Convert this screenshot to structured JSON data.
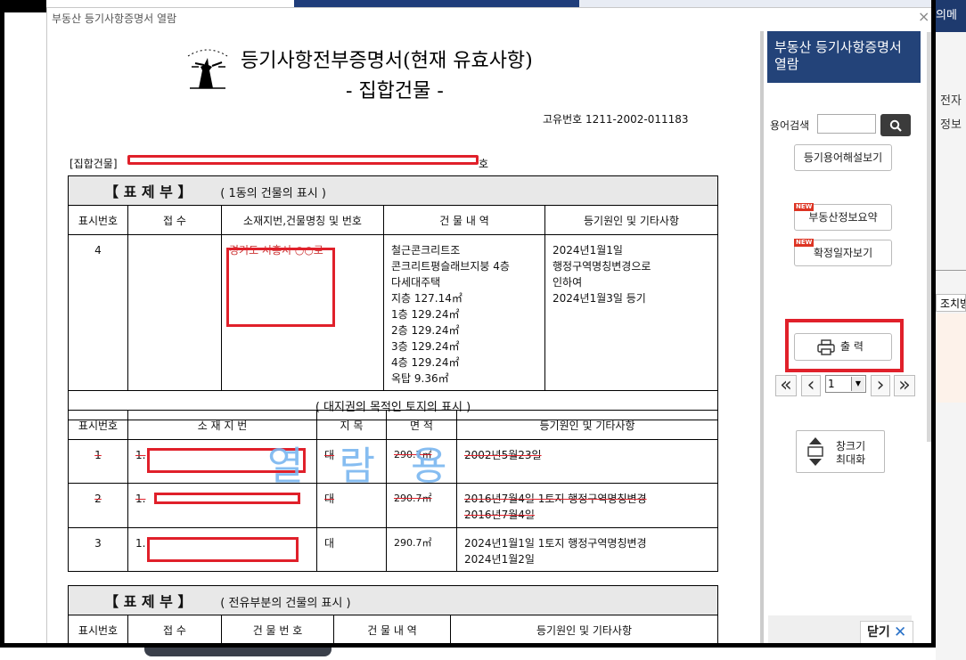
{
  "modal": {
    "title": "부동산 등기사항증명서 열람",
    "close_glyph": "×"
  },
  "background": {
    "right_header": "의메",
    "right_text1": "전자",
    "right_text2": "정보",
    "right_button": "조치방"
  },
  "document": {
    "title": "등기사항전부증명서(현재 유효사항)",
    "subtitle": "- 집합건물 -",
    "unique_number": "고유번호 1211-2002-011183",
    "building_label": "[집합건물]",
    "building_suffix": "호",
    "watermark": "열람용",
    "section1": {
      "bracket": "【 표 제 부 】",
      "desc": "( 1동의 건물의 표시 )",
      "headers": [
        "표시번호",
        "접 수",
        "소재지번,건물명칭 및 번호",
        "건 물 내 역",
        "등기원인 및 기타사항"
      ],
      "row": {
        "num": "4",
        "receipt": "",
        "location_fragment": "경기도 시흥시 ○○로",
        "building": [
          "철근콘크리트조",
          "콘크리트평슬래브지붕 4층",
          "다세대주택",
          "지층 127.14㎡",
          "1층  129.24㎡",
          "2층  129.24㎡",
          "3층  129.24㎡",
          "4층  129.24㎡",
          "옥탑 9.36㎡"
        ],
        "cause": [
          "2024년1월1일",
          "행정구역명칭변경으로",
          "인하여",
          "2024년1월3일  등기"
        ]
      }
    },
    "land_section": {
      "title": "( 대지권의 목적인 토지의 표시 )",
      "headers": [
        "표시번호",
        "소 재 지 번",
        "지 목",
        "면 적",
        "등기원인 및 기타사항"
      ],
      "rows": [
        {
          "num": "1",
          "loc": "1.",
          "type": "대",
          "area": "290.7㎡",
          "cause": [
            "2002년5월23일"
          ],
          "struck": true
        },
        {
          "num": "2",
          "loc": "1.",
          "type": "대",
          "area": "290.7㎡",
          "cause": [
            "2016년7월4일 1토지 행정구역명칭변경",
            "2016년7월4일"
          ],
          "struck": true
        },
        {
          "num": "3",
          "loc": "1.",
          "type": "대",
          "area": "290.7㎡",
          "cause": [
            "2024년1월1일 1토지 행정구역명칭변경",
            "2024년1월2일"
          ],
          "struck": false
        }
      ]
    },
    "section2": {
      "bracket": "【 표 제 부 】",
      "desc": "( 전유부분의 건물의 표시 )",
      "headers": [
        "표시번호",
        "접 수",
        "건 물 번 호",
        "건 물 내 역",
        "등기원인 및 기타사항"
      ]
    }
  },
  "sidebar": {
    "header": "부동산 등기사항증명서 열람",
    "term_search_label": "용어검색",
    "term_search_value": "",
    "term_help_button": "등기용어해설보기",
    "new_badge": "NEW",
    "summary_button": "부동산정보요약",
    "date_button": "확정일자보기",
    "print_button": "출 력",
    "page_first": "«",
    "page_prev": "‹",
    "page_select": "1",
    "page_next": "›",
    "page_last": "»",
    "maximize_button_line1": "창크기",
    "maximize_button_line2": "최대화",
    "close_button": "닫기",
    "close_icon": "✕"
  },
  "colors": {
    "sidebar_header": "#234379",
    "redaction": "#e0202a",
    "watermark": "#7ab6f0"
  }
}
